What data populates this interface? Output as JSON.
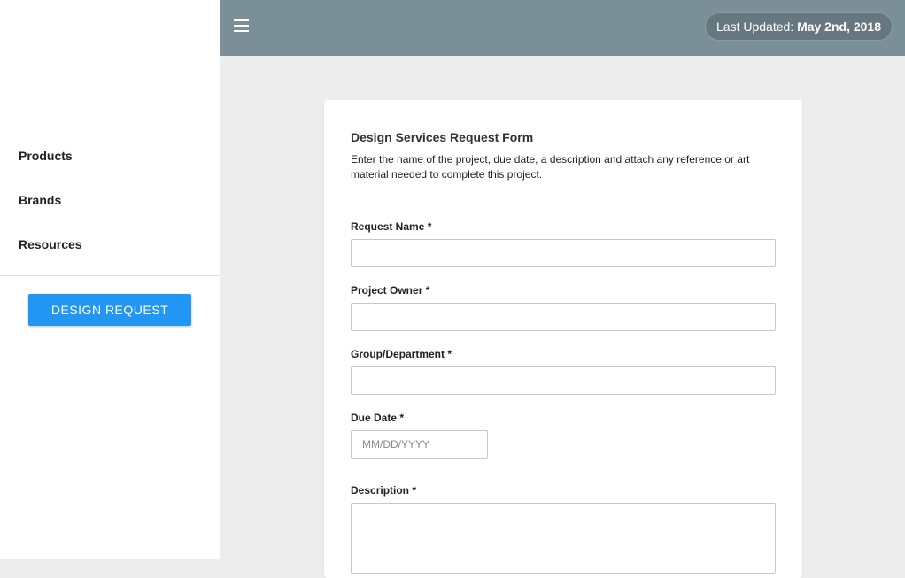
{
  "sidebar": {
    "nav_items": [
      {
        "label": "Products"
      },
      {
        "label": "Brands"
      },
      {
        "label": "Resources"
      }
    ],
    "design_request_label": "DESIGN REQUEST"
  },
  "topbar": {
    "menu_icon": "hamburger-menu-icon",
    "last_updated_prefix": "Last Updated: ",
    "last_updated_date": "May 2nd, 2018"
  },
  "form": {
    "title": "Design Services Request Form",
    "description": "Enter the name of the project, due date, a description and attach any reference or art material needed to complete this project.",
    "fields": {
      "request_name": {
        "label": "Request Name *",
        "value": ""
      },
      "project_owner": {
        "label": "Project Owner *",
        "value": ""
      },
      "group_department": {
        "label": "Group/Department *",
        "value": ""
      },
      "due_date": {
        "label": "Due Date *",
        "placeholder": "MM/DD/YYYY",
        "value": ""
      },
      "description": {
        "label": "Description *",
        "value": ""
      }
    }
  },
  "colors": {
    "topbar": "#7b8f99",
    "accent_button": "#2196f3",
    "page_background": "#ededed"
  }
}
